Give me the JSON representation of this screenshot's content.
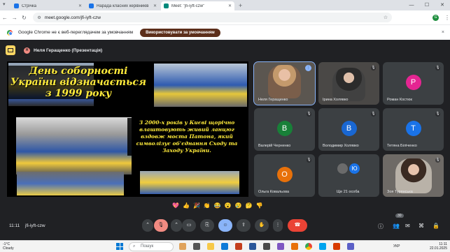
{
  "browser": {
    "tabs": [
      {
        "title": "Стрічка",
        "color": "#1a73e8"
      },
      {
        "title": "Нарада класних керівників",
        "color": "#1a73e8"
      },
      {
        "title": "Meet: \"jfi-iyft-czw\"",
        "color": "#00897b"
      }
    ],
    "new_tab": "+",
    "url": "meet.google.com/jfi-iyft-czw",
    "profile_initial": "G"
  },
  "infobar": {
    "message": "Google Chrome не є веб-переглядачем за умовчанням",
    "button": "Використовувати за умовчанням",
    "close": "×"
  },
  "meet": {
    "presenter": "Неля Геращенко (Презентація)",
    "slide": {
      "title": "День соборності України відзначається з 1999 року",
      "body": "З 2000-х років у Києві щорічно влаштовують живий ланцюг вздовж моста Патона, який символізує об'єднання Сходу та Заходу України."
    },
    "participants": [
      {
        "name": "Неля Геращенко",
        "type": "video"
      },
      {
        "name": "Ірина Холявко",
        "type": "video"
      },
      {
        "name": "Роман Костюк",
        "initial": "Р",
        "color": "#e52592"
      },
      {
        "name": "Валерій Черненко",
        "initial": "В",
        "color": "#188038"
      },
      {
        "name": "Володимир Холявко",
        "initial": "В",
        "color": "#1967d2"
      },
      {
        "name": "Тетяна Біліченко",
        "initial": "Т",
        "color": "#1a73e8"
      },
      {
        "name": "Ольга Ковальова",
        "initial": "О",
        "color": "#e8710a"
      },
      {
        "name": "Ще 21 особа",
        "initial": "Ю"
      },
      {
        "name": "Зоя Турянська",
        "type": "video"
      }
    ],
    "reactions": [
      "💖",
      "👍",
      "🎉",
      "👏",
      "😂",
      "😮",
      "😢",
      "🤔",
      "👎"
    ],
    "time": "11:11",
    "code": "jfi-iyft-czw",
    "participant_count": "30"
  },
  "taskbar": {
    "temp": "-1°C",
    "weather": "Cloudy",
    "search": "Пошук",
    "lang": "УКР",
    "clock": "11:11",
    "date": "22.01.2025"
  }
}
